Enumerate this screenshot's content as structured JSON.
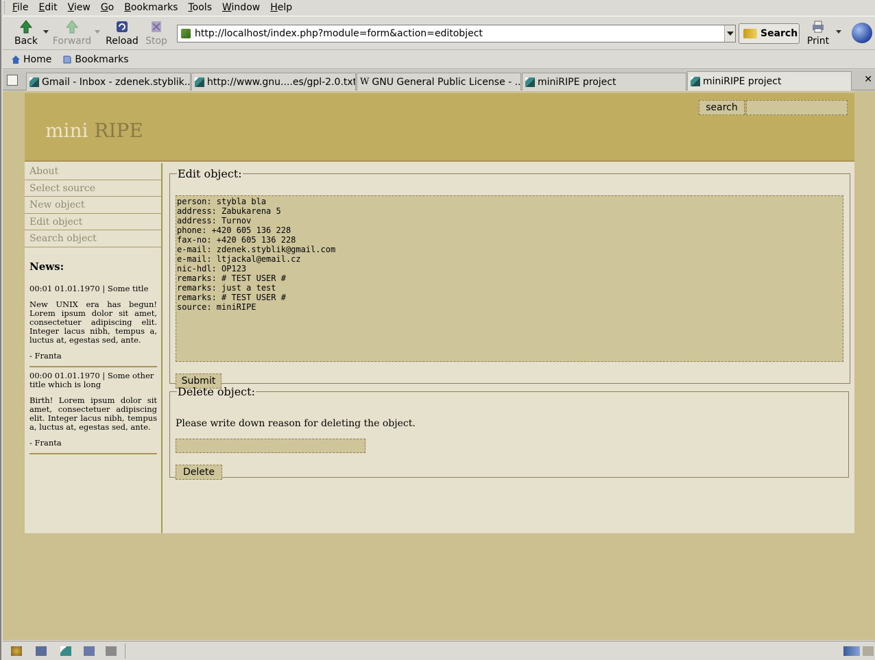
{
  "menubar": {
    "items": [
      "File",
      "Edit",
      "View",
      "Go",
      "Bookmarks",
      "Tools",
      "Window",
      "Help"
    ]
  },
  "toolbar": {
    "back_label": "Back",
    "forward_label": "Forward",
    "reload_label": "Reload",
    "stop_label": "Stop",
    "print_label": "Print",
    "search_label": "Search"
  },
  "address": {
    "url": "http://localhost/index.php?module=form&action=editobject"
  },
  "bookmarks": {
    "home_label": "Home",
    "bookmarks_label": "Bookmarks"
  },
  "tabs": [
    {
      "title": "Gmail - Inbox - zdenek.styblik...",
      "icon": "pen-icon"
    },
    {
      "title": "http://www.gnu....es/gpl-2.0.txt",
      "icon": "pen-icon"
    },
    {
      "title": "GNU General Public License - ...",
      "icon": "wikipedia-icon"
    },
    {
      "title": "miniRIPE project",
      "icon": "pen-icon"
    },
    {
      "title": "miniRIPE project",
      "icon": "pen-icon",
      "active": true
    }
  ],
  "site": {
    "logo_light": "mini",
    "logo_dark": "RIPE",
    "search_button": "search",
    "nav": [
      "About",
      "Select source",
      "New object",
      "Edit object",
      "Search object"
    ],
    "news_heading": "News:",
    "news": [
      {
        "meta": "00:01 01.01.1970 | Some title",
        "body": "New UNIX era has begun! Lorem ipsum dolor sit amet, consectetuer adipiscing elit. Integer lacus nibh, tempus a, luctus at, egestas sed, ante.",
        "author": "- Franta"
      },
      {
        "meta": "00:00 01.01.1970 | Some other title which is long",
        "body": "Birth! Lorem ipsum dolor sit amet, consectetuer adipiscing elit. Integer lacus nibh, tempus a, luctus at, egestas sed, ante.",
        "author": "- Franta"
      }
    ]
  },
  "edit": {
    "legend": "Edit object:",
    "object_text": "person: stybla bla\naddress: Zabukarena 5\naddress: Turnov\nphone: +420 605 136 228\nfax-no: +420 605 136 228\ne-mail: zdenek.styblik@gmail.com\ne-mail: ltjackal@email.cz\nnic-hdl: OP123\nremarks: # TEST USER #\nremarks: just a test\nremarks: # TEST USER #\nsource: miniRIPE",
    "submit_label": "Submit"
  },
  "delete": {
    "legend": "Delete object:",
    "message": "Please write down reason for deleting the object.",
    "reason_value": "",
    "button_label": "Delete"
  },
  "colors": {
    "header_bg": "#c0ad60",
    "page_bg": "#ccc091",
    "panel_bg": "#e5e1cc",
    "field_bg": "#cfc59a"
  }
}
